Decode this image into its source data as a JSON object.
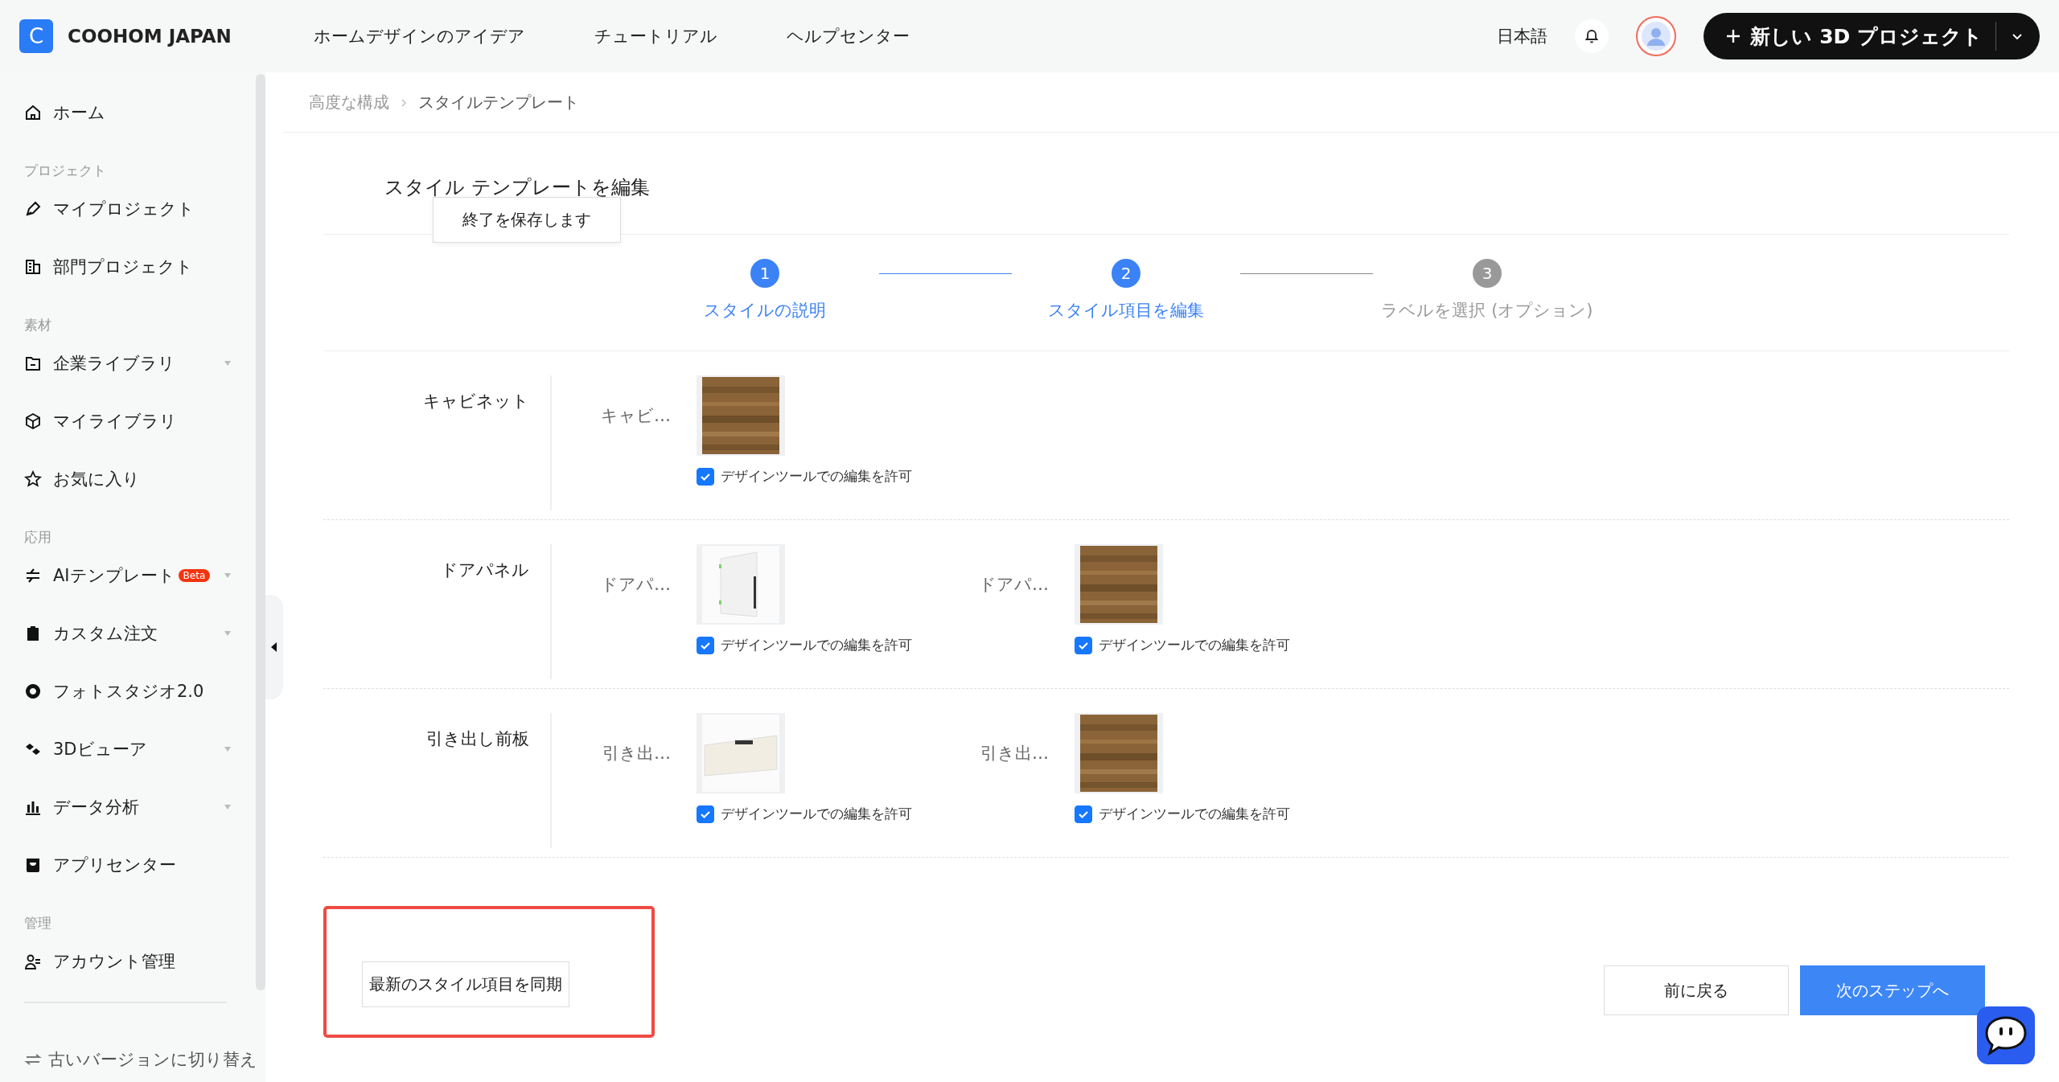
{
  "header": {
    "logo_letter": "C",
    "brand": "COOHOM JAPAN",
    "nav": [
      "ホームデザインのアイデア",
      "チュートリアル",
      "ヘルプセンター"
    ],
    "language": "日本語",
    "new_project": "新しい 3D プロジェクト"
  },
  "sidebar": {
    "items": [
      {
        "kind": "item",
        "label": "ホーム",
        "expandable": false
      },
      {
        "kind": "section",
        "label": "プロジェクト"
      },
      {
        "kind": "item",
        "label": "マイプロジェクト",
        "expandable": false
      },
      {
        "kind": "item",
        "label": "部門プロジェクト",
        "expandable": false
      },
      {
        "kind": "section",
        "label": "素材"
      },
      {
        "kind": "item",
        "label": "企業ライブラリ",
        "expandable": true
      },
      {
        "kind": "item",
        "label": "マイライブラリ",
        "expandable": false
      },
      {
        "kind": "item",
        "label": "お気に入り",
        "expandable": false
      },
      {
        "kind": "section",
        "label": "応用"
      },
      {
        "kind": "item",
        "label": "AIテンプレート",
        "badge": "Beta",
        "expandable": true
      },
      {
        "kind": "item",
        "label": "カスタム注文",
        "expandable": true
      },
      {
        "kind": "item",
        "label": "フォトスタジオ2.0",
        "expandable": false
      },
      {
        "kind": "item",
        "label": "3Dビューア",
        "expandable": true
      },
      {
        "kind": "item",
        "label": "データ分析",
        "expandable": true
      },
      {
        "kind": "item",
        "label": "アプリセンター",
        "expandable": false
      },
      {
        "kind": "section",
        "label": "管理"
      },
      {
        "kind": "item",
        "label": "アカウント管理",
        "expandable": false
      }
    ],
    "footer": "古いバージョンに切り替え"
  },
  "breadcrumb": [
    "高度な構成",
    "スタイルテンプレート"
  ],
  "title": "スタイル テンプレートを編集",
  "tooltip": "終了を保存します",
  "steps": [
    {
      "number": "1",
      "label": "スタイルの説明",
      "active": true
    },
    {
      "number": "2",
      "label": "スタイル項目を編集",
      "active": true
    },
    {
      "number": "3",
      "label": "ラベルを選択 (オプション)",
      "active": false
    }
  ],
  "rows": [
    {
      "label": "キャビネット",
      "items": [
        {
          "caption": "キャビ…",
          "kind": "picture",
          "checked": true,
          "option": "デザインツールでの編集を許可"
        }
      ]
    },
    {
      "label": "ドアパネル",
      "items": [
        {
          "caption": "ドアパ…",
          "kind": "picture",
          "checked": true,
          "option": "デザインツールでの編集を許可"
        },
        {
          "caption": "ドアパ…",
          "kind": "picture",
          "checked": true,
          "option": "デザインツールでの編集を許可"
        }
      ]
    },
    {
      "label": "引き出し前板",
      "items": [
        {
          "caption": "引き出…",
          "kind": "picture",
          "checked": true,
          "option": "デザインツールでの編集を許可"
        },
        {
          "caption": "引き出…",
          "kind": "picture",
          "checked": true,
          "option": "デザインツールでの編集を許可"
        }
      ]
    }
  ],
  "sync_button": "最新のスタイル項目を同期",
  "back_button": "前に戻る",
  "next_button": "次のステップへ"
}
